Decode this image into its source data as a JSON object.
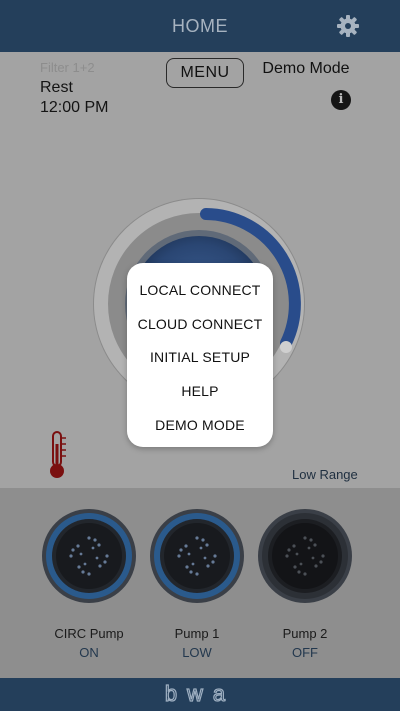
{
  "header": {
    "title": "HOME",
    "settings_icon": "gear-icon"
  },
  "status": {
    "filter": "Filter 1+2",
    "mode": "Rest",
    "time": "12:00 PM"
  },
  "toolbar": {
    "menu_label": "MENU",
    "demo_mode_label": "Demo Mode",
    "info_icon": "info-icon",
    "info_glyph": "i"
  },
  "range_label": "Low Range",
  "popup_menu": {
    "items": [
      "LOCAL CONNECT",
      "CLOUD CONNECT",
      "INITIAL SETUP",
      "HELP",
      "DEMO MODE"
    ]
  },
  "pumps": [
    {
      "name": "CIRC Pump",
      "state": "ON",
      "active": true
    },
    {
      "name": "Pump 1",
      "state": "LOW",
      "active": true
    },
    {
      "name": "Pump 2",
      "state": "OFF",
      "active": false
    }
  ],
  "footer": {
    "logo_text": "bwa"
  },
  "colors": {
    "header_bg": "#243f5b",
    "accent_blue": "#2c5fa8",
    "popup_bg": "#ffffff"
  }
}
